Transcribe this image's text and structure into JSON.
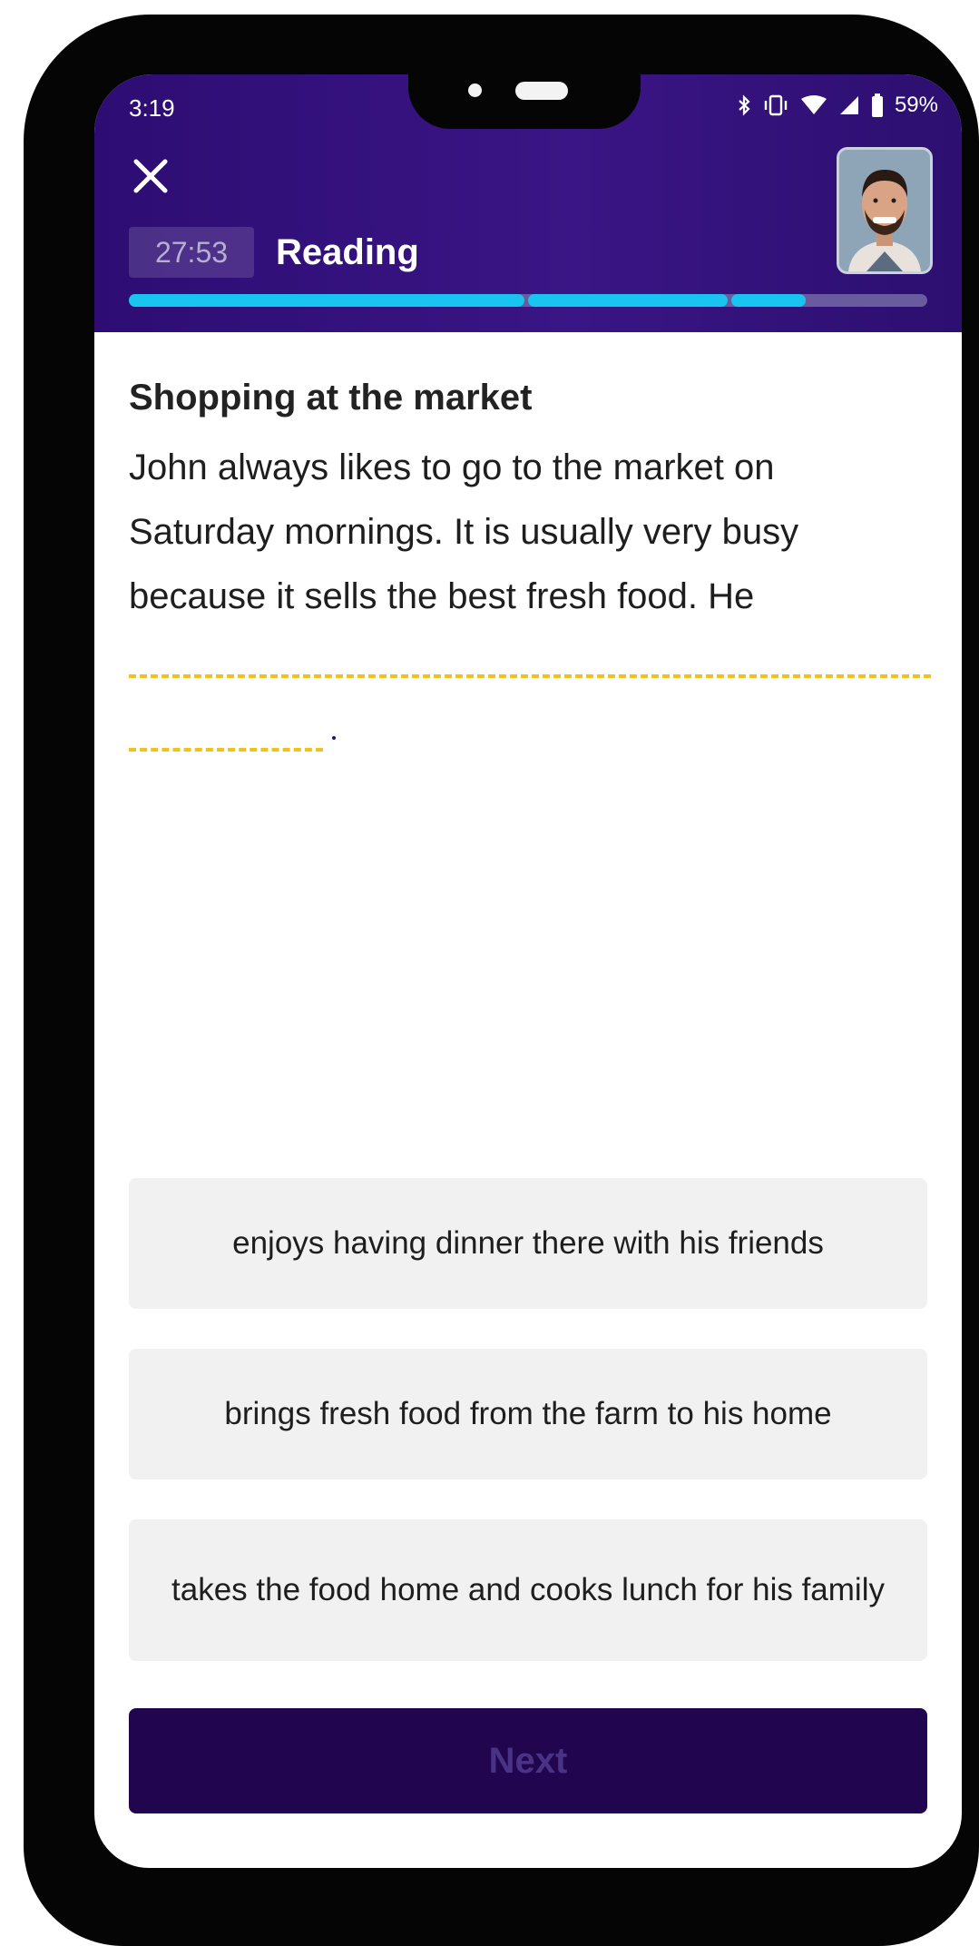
{
  "status_bar": {
    "time": "3:19",
    "battery": "59%",
    "icons": [
      "bluetooth-icon",
      "vibrate-icon",
      "wifi-icon",
      "signal-icon",
      "battery-icon"
    ]
  },
  "header": {
    "timer": "27:53",
    "section": "Reading",
    "close_icon": "close-icon",
    "progress": {
      "completed_segments": 2,
      "current_segment_fraction": 0.38,
      "total_segments": 3
    }
  },
  "content": {
    "title": "Shopping at the market",
    "passage": "John always likes to go to the market on Saturday mornings. It is usually very busy because it sells the best fresh food. He",
    "blank_end": "."
  },
  "options": [
    {
      "label": "enjoys having dinner there with his friends"
    },
    {
      "label": "brings fresh food from the farm to his home"
    },
    {
      "label": "takes the food home and cooks lunch for his family"
    }
  ],
  "actions": {
    "next_label": "Next"
  },
  "colors": {
    "header_bg": "#2d0d73",
    "progress_active": "#19c4f0",
    "progress_track": "#6a5a9e",
    "blank_dash": "#f2c21b",
    "option_bg": "#f1f1f1",
    "next_bg": "#21064f",
    "next_text": "#4a3385"
  }
}
